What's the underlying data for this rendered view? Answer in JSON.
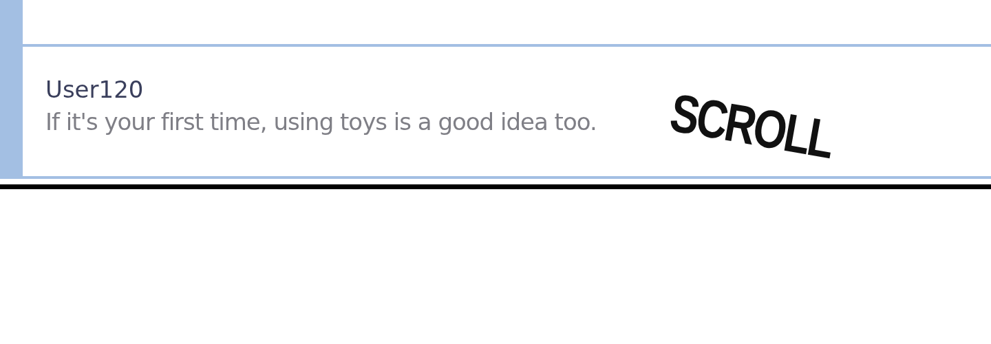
{
  "comment": {
    "user": "User120",
    "text": "If it's your first time, using toys is a good idea too."
  },
  "sound_effect": "SCROLL"
}
